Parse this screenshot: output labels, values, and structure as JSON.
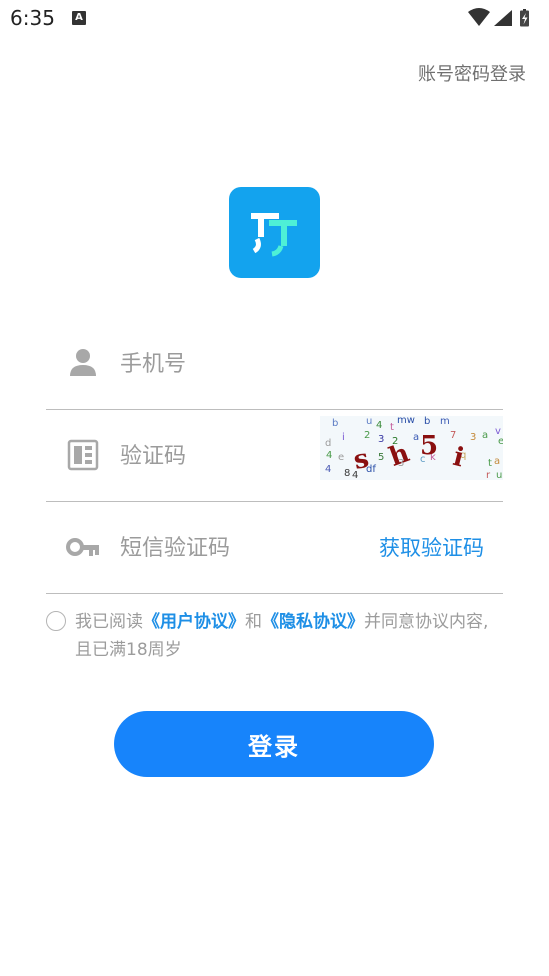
{
  "status_bar": {
    "time": "6:35",
    "notification_badge": "A",
    "icons": [
      "wifi-icon",
      "signal-icon",
      "battery-charging-icon"
    ]
  },
  "header": {
    "account_password_login": "账号密码登录"
  },
  "logo": {
    "icon": "app-logo-icon",
    "bg_color": "#13a3ee"
  },
  "form": {
    "phone": {
      "icon": "user-icon",
      "placeholder": "手机号",
      "value": ""
    },
    "captcha": {
      "icon": "captcha-icon",
      "placeholder": "验证码",
      "value": "",
      "image_text": "sh5i"
    },
    "sms_code": {
      "icon": "key-icon",
      "placeholder": "短信验证码",
      "value": "",
      "get_code_label": "获取验证码"
    }
  },
  "agreement": {
    "checked": false,
    "prefix": "我已阅读",
    "user_agreement": "《用户协议》",
    "and": "和",
    "privacy_agreement": "《隐私协议》",
    "suffix": "并同意协议内容,且已满18周岁"
  },
  "login_button": {
    "label": "登录",
    "color": "#1784fb"
  },
  "colors": {
    "link": "#1e8fe6",
    "placeholder": "#9b9b9b",
    "divider": "#bdbdbd"
  }
}
